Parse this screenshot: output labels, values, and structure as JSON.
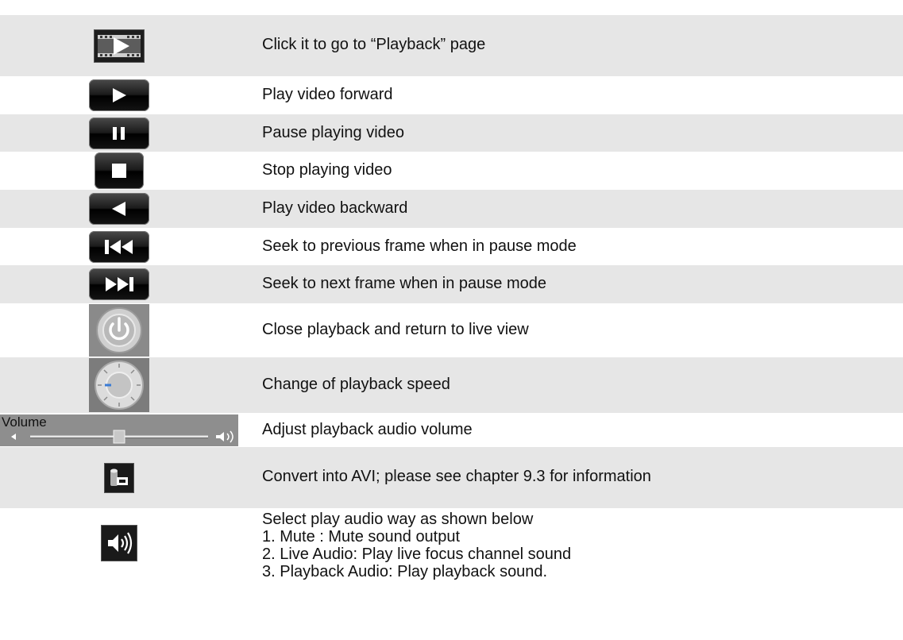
{
  "rows": [
    {
      "icon": "playback-page-film-icon",
      "text": "Click it to go to “Playback” page"
    },
    {
      "icon": "play-forward-icon",
      "text": "Play video forward"
    },
    {
      "icon": "pause-icon",
      "text": "Pause playing video"
    },
    {
      "icon": "stop-icon",
      "text": "Stop playing video"
    },
    {
      "icon": "play-backward-icon",
      "text": "Play video backward"
    },
    {
      "icon": "previous-frame-icon",
      "text": "Seek to previous frame when in pause mode"
    },
    {
      "icon": "next-frame-icon",
      "text": "Seek to next frame when in pause mode"
    },
    {
      "icon": "power-close-icon",
      "text": "Close playback and return to live view"
    },
    {
      "icon": "speed-dial-icon",
      "text": "Change of playback speed"
    },
    {
      "icon": "volume-slider-icon",
      "text": "Adjust playback audio volume",
      "icon_label": "Volume"
    },
    {
      "icon": "convert-avi-icon",
      "text": "Convert into AVI; please see chapter 9.3 for information"
    },
    {
      "icon": "audio-speaker-icon",
      "lines": [
        "Select play audio way as shown below",
        "1. Mute : Mute sound output",
        "2. Live Audio: Play live focus channel sound",
        "3. Playback Audio: Play playback sound."
      ]
    }
  ],
  "volume_level": 0.5
}
